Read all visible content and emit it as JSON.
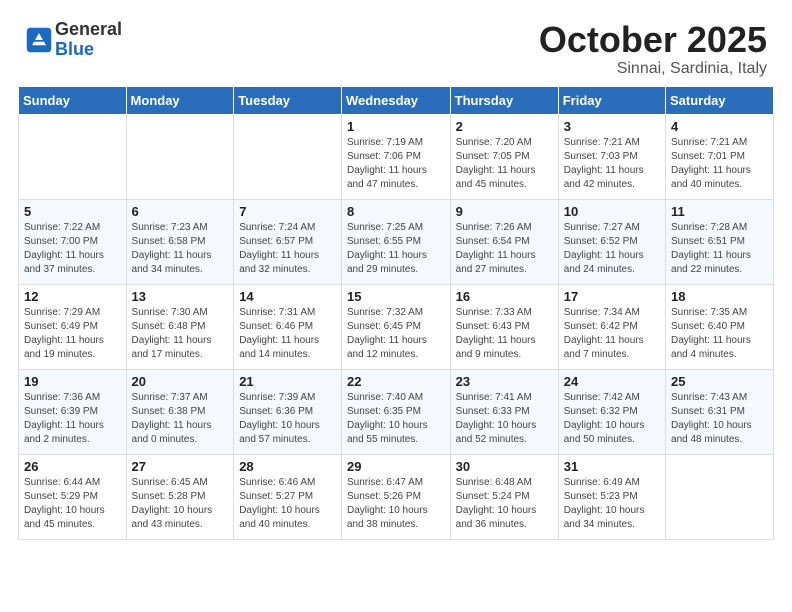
{
  "header": {
    "logo_general": "General",
    "logo_blue": "Blue",
    "month_title": "October 2025",
    "subtitle": "Sinnai, Sardinia, Italy"
  },
  "days_of_week": [
    "Sunday",
    "Monday",
    "Tuesday",
    "Wednesday",
    "Thursday",
    "Friday",
    "Saturday"
  ],
  "weeks": [
    [
      {
        "day": "",
        "info": ""
      },
      {
        "day": "",
        "info": ""
      },
      {
        "day": "",
        "info": ""
      },
      {
        "day": "1",
        "info": "Sunrise: 7:19 AM\nSunset: 7:06 PM\nDaylight: 11 hours and 47 minutes."
      },
      {
        "day": "2",
        "info": "Sunrise: 7:20 AM\nSunset: 7:05 PM\nDaylight: 11 hours and 45 minutes."
      },
      {
        "day": "3",
        "info": "Sunrise: 7:21 AM\nSunset: 7:03 PM\nDaylight: 11 hours and 42 minutes."
      },
      {
        "day": "4",
        "info": "Sunrise: 7:21 AM\nSunset: 7:01 PM\nDaylight: 11 hours and 40 minutes."
      }
    ],
    [
      {
        "day": "5",
        "info": "Sunrise: 7:22 AM\nSunset: 7:00 PM\nDaylight: 11 hours and 37 minutes."
      },
      {
        "day": "6",
        "info": "Sunrise: 7:23 AM\nSunset: 6:58 PM\nDaylight: 11 hours and 34 minutes."
      },
      {
        "day": "7",
        "info": "Sunrise: 7:24 AM\nSunset: 6:57 PM\nDaylight: 11 hours and 32 minutes."
      },
      {
        "day": "8",
        "info": "Sunrise: 7:25 AM\nSunset: 6:55 PM\nDaylight: 11 hours and 29 minutes."
      },
      {
        "day": "9",
        "info": "Sunrise: 7:26 AM\nSunset: 6:54 PM\nDaylight: 11 hours and 27 minutes."
      },
      {
        "day": "10",
        "info": "Sunrise: 7:27 AM\nSunset: 6:52 PM\nDaylight: 11 hours and 24 minutes."
      },
      {
        "day": "11",
        "info": "Sunrise: 7:28 AM\nSunset: 6:51 PM\nDaylight: 11 hours and 22 minutes."
      }
    ],
    [
      {
        "day": "12",
        "info": "Sunrise: 7:29 AM\nSunset: 6:49 PM\nDaylight: 11 hours and 19 minutes."
      },
      {
        "day": "13",
        "info": "Sunrise: 7:30 AM\nSunset: 6:48 PM\nDaylight: 11 hours and 17 minutes."
      },
      {
        "day": "14",
        "info": "Sunrise: 7:31 AM\nSunset: 6:46 PM\nDaylight: 11 hours and 14 minutes."
      },
      {
        "day": "15",
        "info": "Sunrise: 7:32 AM\nSunset: 6:45 PM\nDaylight: 11 hours and 12 minutes."
      },
      {
        "day": "16",
        "info": "Sunrise: 7:33 AM\nSunset: 6:43 PM\nDaylight: 11 hours and 9 minutes."
      },
      {
        "day": "17",
        "info": "Sunrise: 7:34 AM\nSunset: 6:42 PM\nDaylight: 11 hours and 7 minutes."
      },
      {
        "day": "18",
        "info": "Sunrise: 7:35 AM\nSunset: 6:40 PM\nDaylight: 11 hours and 4 minutes."
      }
    ],
    [
      {
        "day": "19",
        "info": "Sunrise: 7:36 AM\nSunset: 6:39 PM\nDaylight: 11 hours and 2 minutes."
      },
      {
        "day": "20",
        "info": "Sunrise: 7:37 AM\nSunset: 6:38 PM\nDaylight: 11 hours and 0 minutes."
      },
      {
        "day": "21",
        "info": "Sunrise: 7:39 AM\nSunset: 6:36 PM\nDaylight: 10 hours and 57 minutes."
      },
      {
        "day": "22",
        "info": "Sunrise: 7:40 AM\nSunset: 6:35 PM\nDaylight: 10 hours and 55 minutes."
      },
      {
        "day": "23",
        "info": "Sunrise: 7:41 AM\nSunset: 6:33 PM\nDaylight: 10 hours and 52 minutes."
      },
      {
        "day": "24",
        "info": "Sunrise: 7:42 AM\nSunset: 6:32 PM\nDaylight: 10 hours and 50 minutes."
      },
      {
        "day": "25",
        "info": "Sunrise: 7:43 AM\nSunset: 6:31 PM\nDaylight: 10 hours and 48 minutes."
      }
    ],
    [
      {
        "day": "26",
        "info": "Sunrise: 6:44 AM\nSunset: 5:29 PM\nDaylight: 10 hours and 45 minutes."
      },
      {
        "day": "27",
        "info": "Sunrise: 6:45 AM\nSunset: 5:28 PM\nDaylight: 10 hours and 43 minutes."
      },
      {
        "day": "28",
        "info": "Sunrise: 6:46 AM\nSunset: 5:27 PM\nDaylight: 10 hours and 40 minutes."
      },
      {
        "day": "29",
        "info": "Sunrise: 6:47 AM\nSunset: 5:26 PM\nDaylight: 10 hours and 38 minutes."
      },
      {
        "day": "30",
        "info": "Sunrise: 6:48 AM\nSunset: 5:24 PM\nDaylight: 10 hours and 36 minutes."
      },
      {
        "day": "31",
        "info": "Sunrise: 6:49 AM\nSunset: 5:23 PM\nDaylight: 10 hours and 34 minutes."
      },
      {
        "day": "",
        "info": ""
      }
    ]
  ]
}
